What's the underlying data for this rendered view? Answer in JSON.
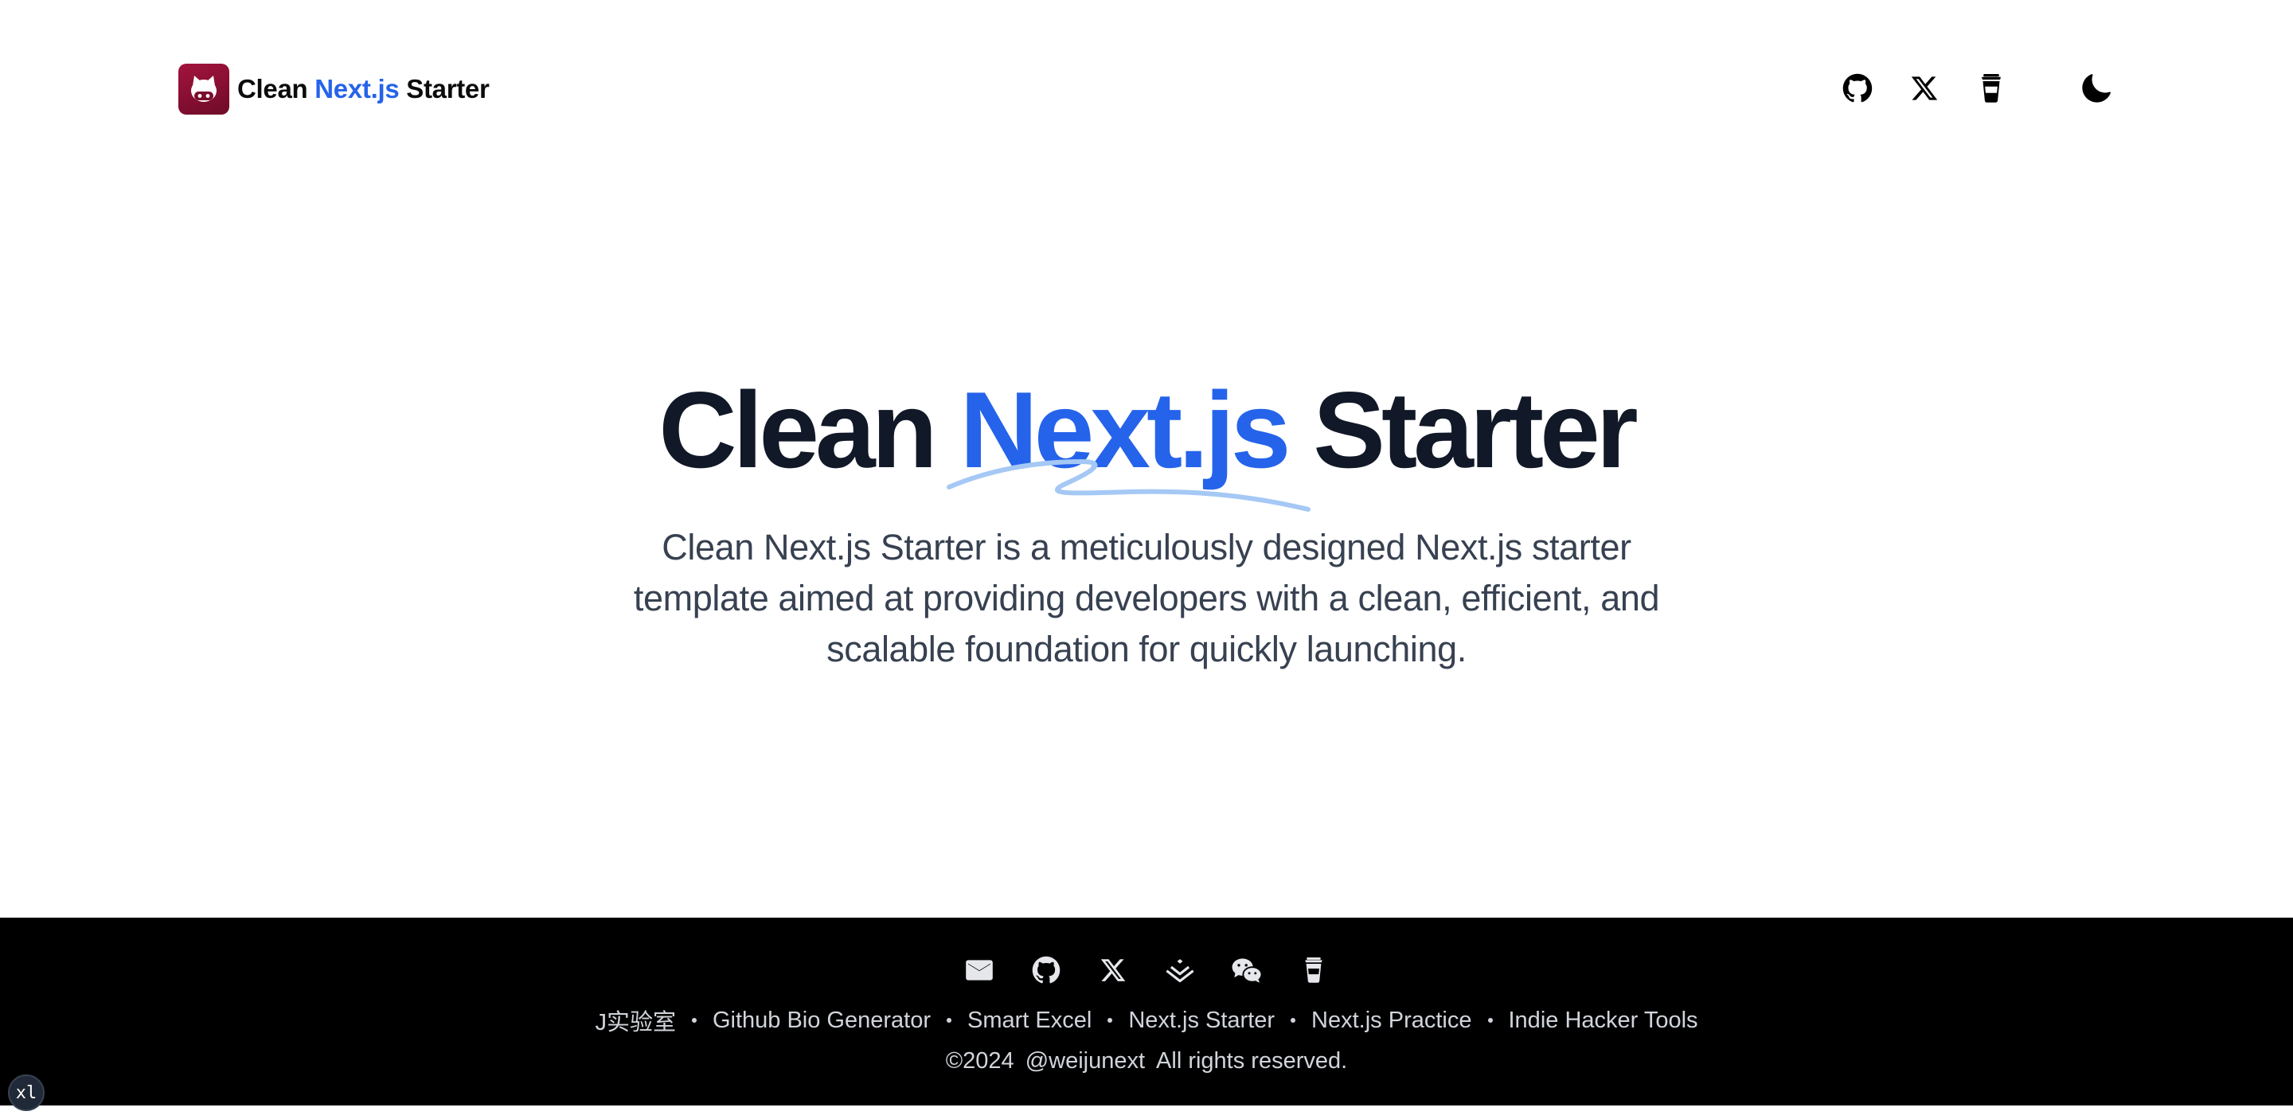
{
  "header": {
    "brand_prefix": "Clean",
    "brand_accent": "Next.js",
    "brand_suffix": "Starter",
    "icons": [
      "github-icon",
      "x-icon",
      "buymeacoffee-icon",
      "moon-icon"
    ]
  },
  "hero": {
    "title_prefix": "Clean",
    "title_accent": "Next.js",
    "title_suffix": "Starter",
    "description": "Clean Next.js Starter is a meticulously designed Next.js starter template aimed at providing developers with a clean, efficient, and scalable foundation for quickly launching."
  },
  "footer": {
    "icons": [
      "mail-icon",
      "github-icon",
      "x-icon",
      "juejin-icon",
      "wechat-icon",
      "buymeacoffee-icon"
    ],
    "links": [
      "J实验室",
      "Github Bio Generator",
      "Smart Excel",
      "Next.js Starter",
      "Next.js Practice",
      "Indie Hacker Tools"
    ],
    "copyright_year": "©2024",
    "copyright_handle": "@weijunext",
    "copyright_text": "All rights reserved."
  },
  "breakpoint_badge": "xl",
  "colors": {
    "accent": "#2563eb",
    "title": "#111827",
    "body_text": "#374151",
    "footer_bg": "#000000",
    "footer_text": "#d1d5db",
    "logo_bg": "#8b0f35"
  }
}
